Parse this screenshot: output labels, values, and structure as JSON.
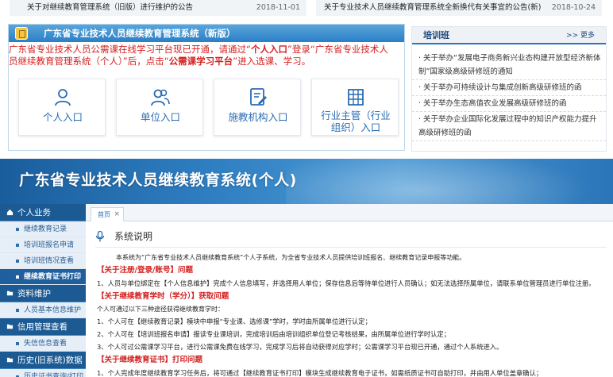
{
  "notices": [
    {
      "text": "关于对继续教育管理系统（旧版）进行维护的公告",
      "date": "2018-11-01"
    },
    {
      "text": "关于专业技术人员继续教育管理系统全新换代有关事宜的公告(新)",
      "date": "2018-10-24"
    }
  ],
  "main_panel": {
    "title": "广东省专业技术人员继续教育管理系统（新版）",
    "notice_line1_a": "广东省专业技术人员公需课在线学习平台现已开通，请通过“",
    "notice_line1_b": "个人入口",
    "notice_line1_c": "”登录“广东省专业技术人",
    "notice_line2_a": "员继续教育管理系统（个人）”后，点击“",
    "notice_line2_b": "公需课学习平台",
    "notice_line2_c": "”进入选课、学习。",
    "entries": [
      {
        "label": "个人入口",
        "icon": "person-icon"
      },
      {
        "label": "单位入口",
        "icon": "group-icon"
      },
      {
        "label": "施教机构入口",
        "icon": "edit-document-icon"
      },
      {
        "label": "行业主管（行业组织）入口",
        "icon": "building-icon"
      }
    ],
    "authority_line1": "行业主管（行业",
    "authority_line2": "组织）入口"
  },
  "training": {
    "title": "培训班",
    "more": ">> 更多",
    "items": [
      "· 关于举办“发展电子商务新兴业态构建开放型经济新体制”国家级高级研修班的通知",
      "· 关于举办可持续设计与集成创新高级研修班的函",
      "· 关于举办生态高值农业发展高级研修班的函",
      "· 关于举办企业国际化发展过程中的知识产权能力提升高级研修班的函"
    ]
  },
  "banner": {
    "title": "广东省专业技术人员继续教育系统(个人)"
  },
  "sidebar": {
    "groups": [
      {
        "label": "个人业务",
        "icon": "home-icon",
        "items": [
          "继续教育记录",
          "培训班报名申请",
          "培训班情况查看",
          "继续教育证书打印"
        ]
      },
      {
        "label": "资料维护",
        "icon": "folder-icon",
        "items": [
          "人员基本信息维护"
        ]
      },
      {
        "label": "信用管理查看",
        "icon": "folder-icon",
        "items": [
          "失信信息查看"
        ]
      },
      {
        "label": "历史(旧系统)数据",
        "icon": "folder-icon",
        "items": [
          "历史证书查询/打印"
        ]
      }
    ],
    "active_item": "继续教育证书打印"
  },
  "content": {
    "tab_label": "首页",
    "tab_close": "×",
    "section_title": "系统说明",
    "intro": "本系统为“广东省专业技术人员继续教育系统”个人子系统，为全省专业技术人员提供培训班报名、继续教育记录申报等功能。",
    "h1": "【关于注册/登录/账号】问题",
    "p1": "1、人员与单位绑定在【个人信息维护】完成个人信息填写，并选择用人单位；保存信息后等待单位进行人员确认；如无法选择所属单位，请联系单位管理员进行单位注册。",
    "h2": "【关于继续教育学时（学分）】获取问题",
    "p2": "个人可通过以下三种途径获得继续教育学时：",
    "l1": "1、个人可在【继续教育记录】模块中申报“专业课、选修课”学时，学时由所属单位进行认定；",
    "l2": "2、个人可在【培训班报名申请】报读专业课培训，完成培训后由培训组织单位登记考核结果，由所属单位进行学时认定；",
    "l3": "3、个人可过公需课学习平台，进行公需课免费在线学习，完成学习后将自动获得对应学时；公需课学习平台现已开通，通过个人系统进入。",
    "h3": "【关于继续教育证书】打印问题",
    "p3": "1、个人完成年度继续教育学习任务后，将可通过【继续教育证书打印】模块生成继续教育电子证书，如需纸质证书可自助打印，并由用人单位盖章确认；"
  },
  "colors": {
    "brand_blue": "#2a7fc6",
    "alert_red": "#d42020",
    "sidebar_blue": "#2f6ea8"
  }
}
